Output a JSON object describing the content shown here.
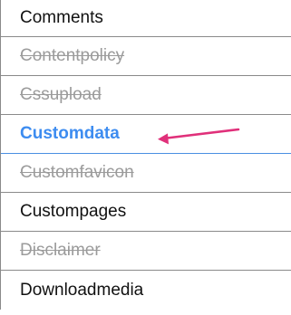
{
  "list": {
    "items": [
      {
        "label": "Comments",
        "state": "normal"
      },
      {
        "label": "Contentpolicy",
        "state": "disabled"
      },
      {
        "label": "Cssupload",
        "state": "disabled"
      },
      {
        "label": "Customdata",
        "state": "active"
      },
      {
        "label": "Customfavicon",
        "state": "disabled"
      },
      {
        "label": "Custompages",
        "state": "normal"
      },
      {
        "label": "Disclaimer",
        "state": "disabled"
      },
      {
        "label": "Downloadmedia",
        "state": "normal"
      }
    ]
  },
  "annotation": {
    "arrow_color": "#e0307a",
    "icon": "pointer-arrow-icon"
  },
  "colors": {
    "active_text": "#3d8cf0",
    "disabled_text": "#9b9b9b",
    "normal_text": "#111111",
    "divider": "#8a8a8a"
  }
}
